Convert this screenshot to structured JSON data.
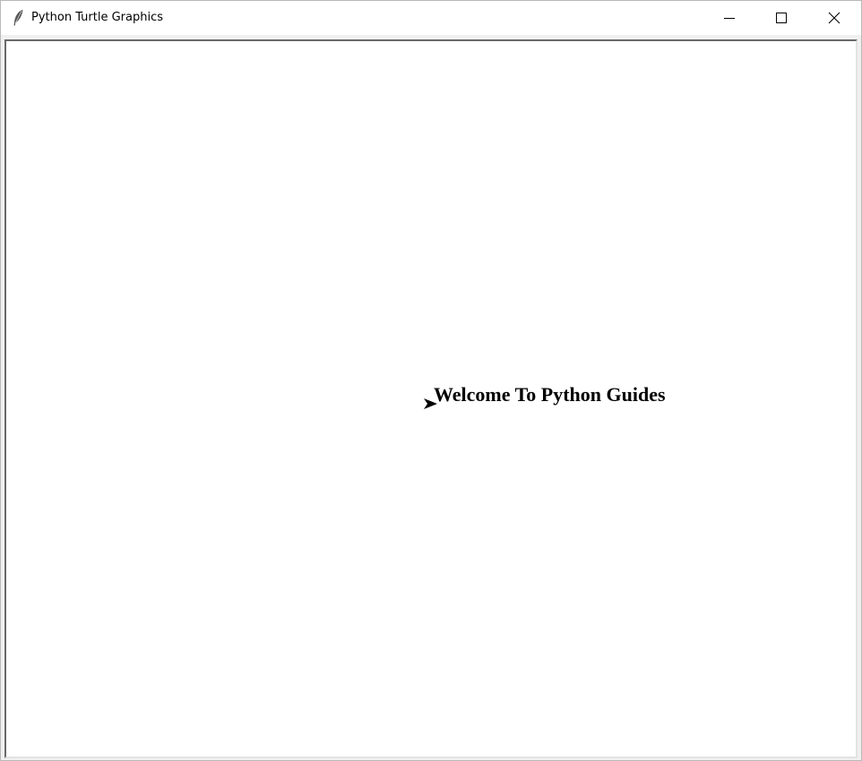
{
  "window": {
    "title": "Python Turtle Graphics",
    "app_icon": "feather-icon",
    "controls": [
      {
        "name": "minimize",
        "icon": "minimize-icon"
      },
      {
        "name": "maximize",
        "icon": "maximize-icon"
      },
      {
        "name": "close",
        "icon": "close-icon"
      }
    ]
  },
  "canvas": {
    "background": "#ffffff",
    "written_text": "Welcome To Python Guides",
    "text_color": "#000000",
    "turtle": {
      "shape": "arrow",
      "heading": "east",
      "icon": "turtle-arrow-icon",
      "color": "#000000"
    }
  }
}
